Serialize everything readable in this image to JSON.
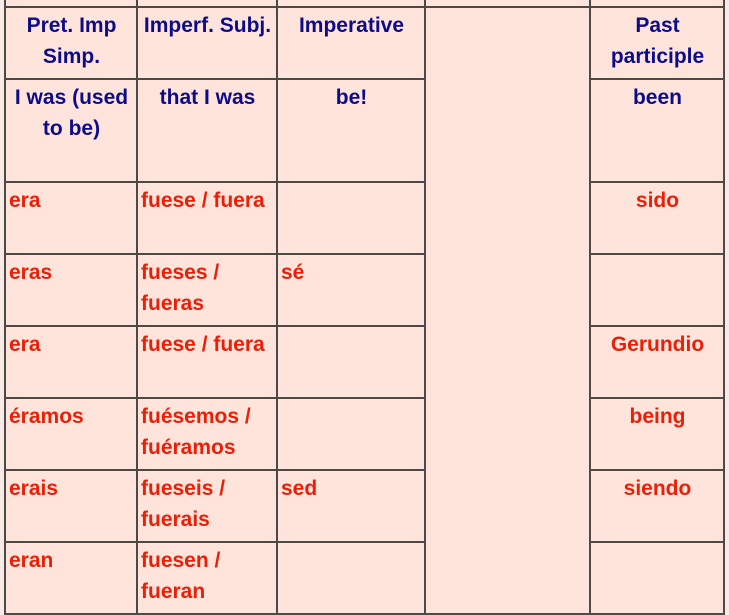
{
  "table": {
    "headers": {
      "pret_imp": "Pret. Imp Simp.",
      "imperf_subj": "Imperf. Subj.",
      "imperative": "Imperative",
      "blank": "",
      "past_participle": "Past participle"
    },
    "translations": {
      "pret_imp": "I was (used to be)",
      "imperf_subj": "that I was",
      "imperative": "be!",
      "past_participle": "been"
    },
    "rows": [
      {
        "pret_imp": "era",
        "imperf_subj": "fuese / fuera",
        "imperative": "",
        "right": "sido"
      },
      {
        "pret_imp": "eras",
        "imperf_subj": "fueses / fueras",
        "imperative": "sé",
        "right": ""
      },
      {
        "pret_imp": "era",
        "imperf_subj": "fuese / fuera",
        "imperative": "",
        "right": "Gerundio"
      },
      {
        "pret_imp": "éramos",
        "imperf_subj": "fuésemos / fuéramos",
        "imperative": "",
        "right": "being"
      },
      {
        "pret_imp": "erais",
        "imperf_subj": "fueseis / fuerais",
        "imperative": "sed",
        "right": "siendo"
      },
      {
        "pret_imp": "eran",
        "imperf_subj": "fuesen / fueran",
        "imperative": "",
        "right": ""
      }
    ]
  },
  "colors": {
    "header_text": "#0c0c8a",
    "conjugation_text": "#e8200a",
    "cell_background": "#ffe4db",
    "border": "#4a4a4a"
  }
}
